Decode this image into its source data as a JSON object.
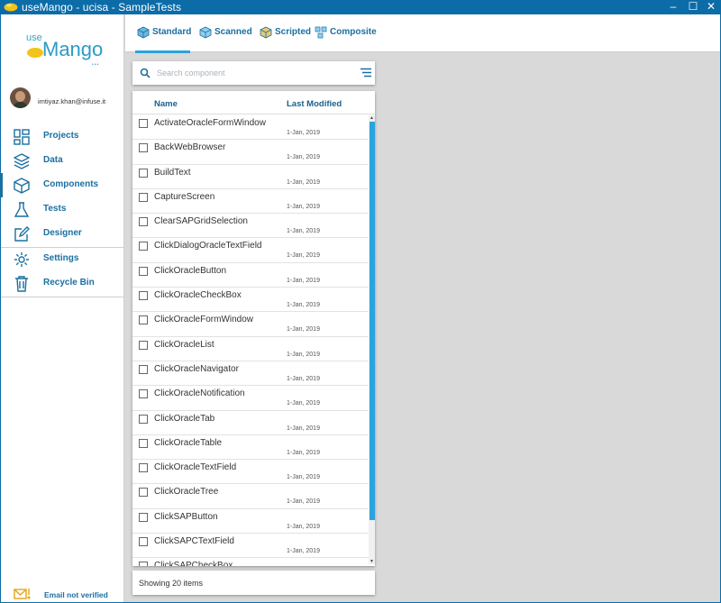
{
  "window": {
    "title": "useMango - ucisa - SampleTests",
    "minimize": "–",
    "maximize": "☐",
    "close": "✕"
  },
  "logo": {
    "prefix": "use",
    "name": "Mango",
    "suffix": "•••"
  },
  "user": {
    "email": "imtiyaz.khan@infuse.it"
  },
  "nav": {
    "projects": "Projects",
    "data": "Data",
    "components": "Components",
    "tests": "Tests",
    "designer": "Designer",
    "settings": "Settings",
    "recycle_bin": "Recycle Bin"
  },
  "email_status": "Email not verified",
  "tabs": {
    "standard": "Standard",
    "scanned": "Scanned",
    "scripted": "Scripted",
    "composite": "Composite"
  },
  "search": {
    "placeholder": "Search component"
  },
  "list": {
    "columns": {
      "name": "Name",
      "modified": "Last Modified"
    },
    "rows": [
      {
        "name": "ActivateOracleFormWindow",
        "date": "1-Jan, 2019"
      },
      {
        "name": "BackWebBrowser",
        "date": "1-Jan, 2019"
      },
      {
        "name": "BuildText",
        "date": "1-Jan, 2019"
      },
      {
        "name": "CaptureScreen",
        "date": "1-Jan, 2019"
      },
      {
        "name": "ClearSAPGridSelection",
        "date": "1-Jan, 2019"
      },
      {
        "name": "ClickDialogOracleTextField",
        "date": "1-Jan, 2019"
      },
      {
        "name": "ClickOracleButton",
        "date": "1-Jan, 2019"
      },
      {
        "name": "ClickOracleCheckBox",
        "date": "1-Jan, 2019"
      },
      {
        "name": "ClickOracleFormWindow",
        "date": "1-Jan, 2019"
      },
      {
        "name": "ClickOracleList",
        "date": "1-Jan, 2019"
      },
      {
        "name": "ClickOracleNavigator",
        "date": "1-Jan, 2019"
      },
      {
        "name": "ClickOracleNotification",
        "date": "1-Jan, 2019"
      },
      {
        "name": "ClickOracleTab",
        "date": "1-Jan, 2019"
      },
      {
        "name": "ClickOracleTable",
        "date": "1-Jan, 2019"
      },
      {
        "name": "ClickOracleTextField",
        "date": "1-Jan, 2019"
      },
      {
        "name": "ClickOracleTree",
        "date": "1-Jan, 2019"
      },
      {
        "name": "ClickSAPButton",
        "date": "1-Jan, 2019"
      },
      {
        "name": "ClickSAPCTextField",
        "date": "1-Jan, 2019"
      },
      {
        "name": "ClickSAPCheckBox",
        "date": ""
      }
    ],
    "footer": "Showing 20 items"
  },
  "colors": {
    "titlebar": "#0c6ca8",
    "accent": "#2aa4dc",
    "nav_text": "#1a6fa1"
  }
}
